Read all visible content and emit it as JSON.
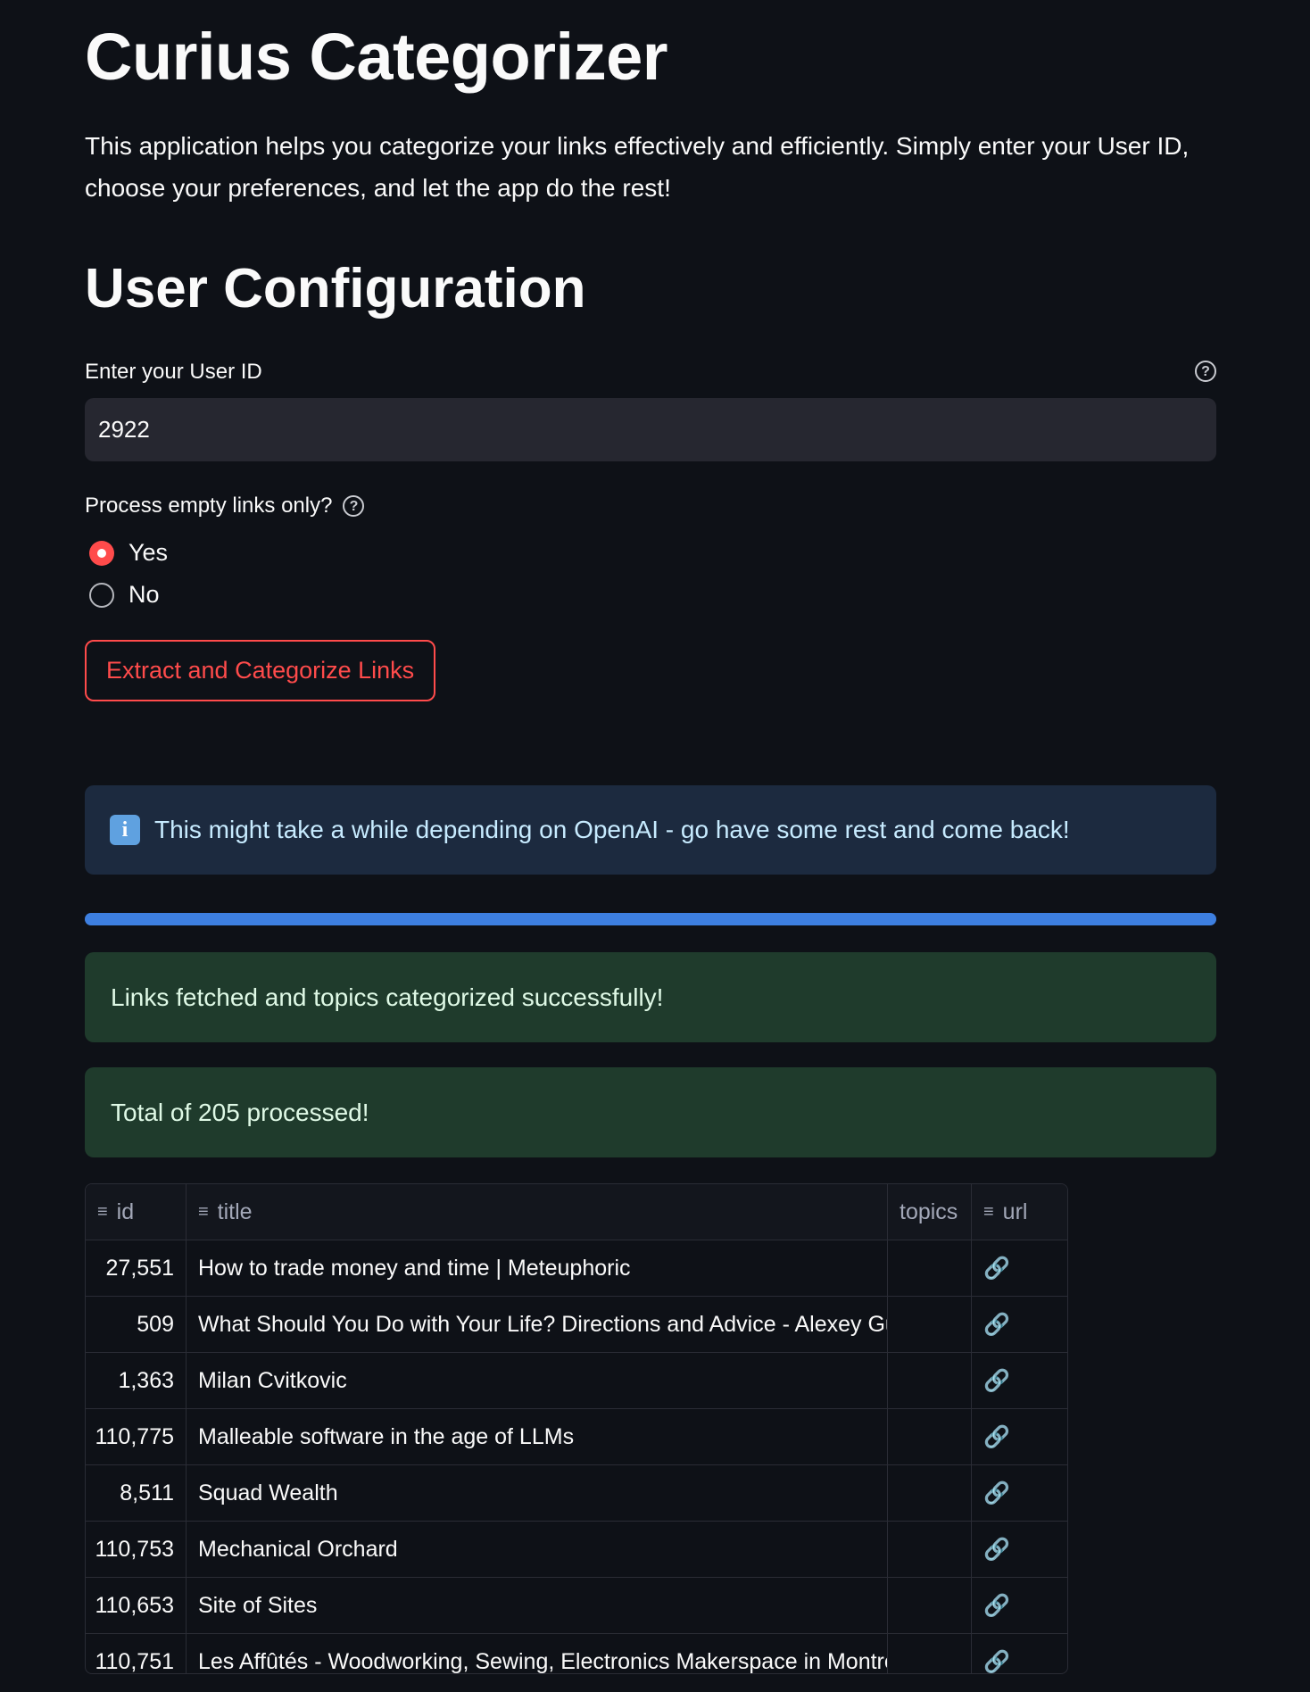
{
  "header": {
    "title": "Curius Categorizer",
    "intro": "This application helps you categorize your links effectively and efficiently. Simply enter your User ID, choose your preferences, and let the app do the rest!"
  },
  "config": {
    "section_title": "User Configuration",
    "user_id_label": "Enter your User ID",
    "user_id_value": "2922",
    "help_glyph": "?",
    "radio_label": "Process empty links only?",
    "radio_options": [
      {
        "label": "Yes",
        "selected": true
      },
      {
        "label": "No",
        "selected": false
      }
    ],
    "button_label": "Extract and Categorize Links"
  },
  "info": {
    "icon": "info-icon",
    "glyph": "i",
    "text": "This might take a while depending on OpenAI - go have some rest and come back!"
  },
  "progress": {
    "value_percent": 100,
    "color": "#3d7fe0"
  },
  "messages": {
    "success_1": "Links fetched and topics categorized successfully!",
    "success_2": "Total of 205 processed!"
  },
  "table": {
    "columns": [
      "id",
      "title",
      "topics",
      "url"
    ],
    "column_icon_glyph": "≡",
    "link_glyph": "🔗",
    "rows": [
      {
        "id": "27,551",
        "title": "How to trade money and time | Meteuphoric",
        "topics": ""
      },
      {
        "id": "509",
        "title": "What Should You Do with Your Life? Directions and Advice - Alexey Guzey",
        "topics": ""
      },
      {
        "id": "1,363",
        "title": "Milan Cvitkovic",
        "topics": ""
      },
      {
        "id": "110,775",
        "title": "Malleable software in the age of LLMs",
        "topics": ""
      },
      {
        "id": "8,511",
        "title": "Squad Wealth",
        "topics": ""
      },
      {
        "id": "110,753",
        "title": "Mechanical Orchard",
        "topics": ""
      },
      {
        "id": "110,653",
        "title": "Site of Sites",
        "topics": ""
      },
      {
        "id": "110,751",
        "title": "Les Affûtés - Woodworking, Sewing, Electronics Makerspace in Montreal",
        "topics": ""
      }
    ]
  },
  "colors": {
    "accent": "#ff4b4b",
    "background": "#0e1117",
    "info_bg": "#1c2a3f",
    "success_bg": "#1f3b2c"
  }
}
